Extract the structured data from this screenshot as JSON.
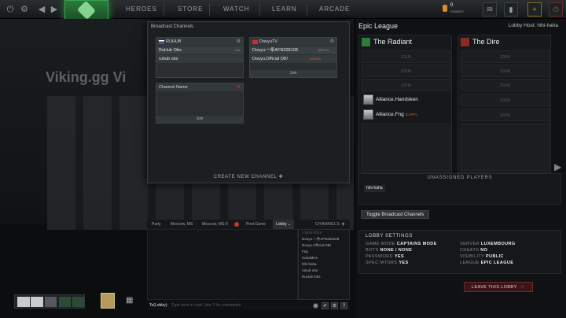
{
  "topbar": {
    "nav": [
      "HEROES",
      "STORE",
      "WATCH",
      "LEARN",
      "ARCADE"
    ],
    "shards_count": "0",
    "shards_label": "SHARDS"
  },
  "background": {
    "title": "Viking.gg Vi"
  },
  "broadcast": {
    "title": "Broadcast Channels",
    "channels": [
      {
        "name": "RUHUB",
        "rows": [
          {
            "text": "RuHub Obs",
            "tag": "CM"
          },
          {
            "text": "ruhub obs",
            "tag": ""
          }
        ]
      },
      {
        "name": "DouyuTV",
        "rows": [
          {
            "text": "Douyu.一条AFN328108",
            "tag": "(RU+1)"
          },
          {
            "text": "Douyu.Official OB!",
            "tag": "(GRAD)"
          }
        ],
        "join": "Join"
      },
      {
        "name": "Channel Name",
        "rows": [],
        "join": "Join"
      }
    ],
    "create_label": "CREATE NEW CHANNEL"
  },
  "chat": {
    "tabs": [
      "Party",
      "Moscow, MS",
      "Moscow, MS-9",
      "Post Game",
      "Lobby"
    ],
    "channels_label": "CHANNELS",
    "channel_list": [
      "7 ROSTERS",
      "Douyu.一条AFN328108",
      "Douyu.Official OB!",
      "Fng",
      "Handsken",
      "hihi-haha",
      "ruhub obs",
      "RuHub Obs"
    ],
    "input_prefix": "To(Lobby):",
    "input_placeholder": "Type here to chat. Use '/' for commands."
  },
  "lobby": {
    "title": "Epic League",
    "host": "Lobby Host: hihi-haha",
    "radiant": {
      "name": "The Radiant",
      "slots": [
        "JOIN",
        "JOIN",
        "JOIN"
      ],
      "players": [
        {
          "name": "Alliance.Handsken",
          "tag": ""
        },
        {
          "name": "Alliance.Fng",
          "tag": "(CAPT)"
        }
      ]
    },
    "dire": {
      "name": "The Dire",
      "slots": [
        "JOIN",
        "JOIN",
        "JOIN",
        "JOIN",
        "JOIN"
      ]
    },
    "unassigned_title": "UNASSIGNED PLAYERS",
    "unassigned": [
      "hihi-haha"
    ],
    "toggle_label": "Toggle Broadcast Channels",
    "settings": {
      "title": "LOBBY SETTINGS",
      "left": [
        [
          "GAME MODE",
          "CAPTAINS MODE"
        ],
        [
          "BOTS",
          "NONE / NONE"
        ],
        [
          "PASSWORD",
          "YES"
        ],
        [
          "SPECTATORS",
          "YES"
        ]
      ],
      "right": [
        [
          "SERVER",
          "LUXEMBOURG"
        ],
        [
          "CHEATS",
          "NO"
        ],
        [
          "VISIBILITY",
          "PUBLIC"
        ],
        [
          "LEAGUE",
          "EPIC LEAGUE"
        ]
      ]
    },
    "leave_label": "LEAVE THIS LOBBY"
  }
}
